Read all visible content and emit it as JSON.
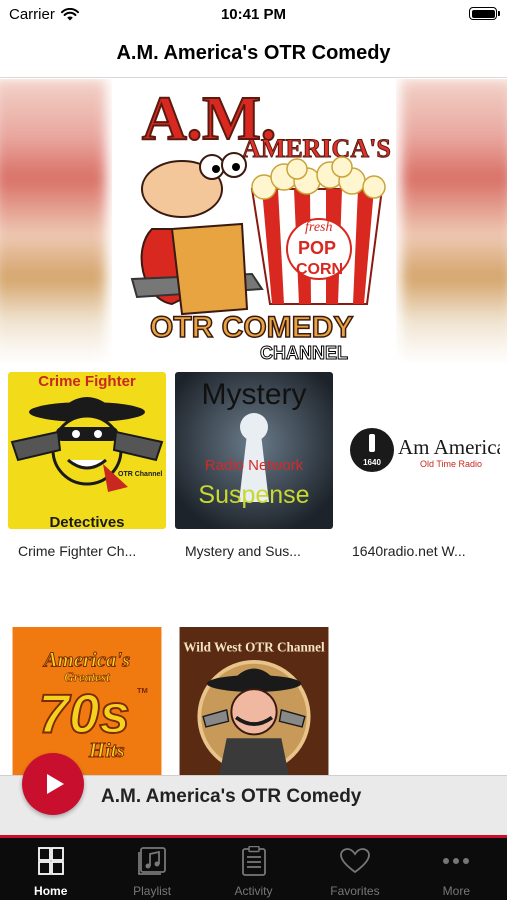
{
  "status_bar": {
    "carrier": "Carrier",
    "time": "10:41 PM",
    "battery_level": 1.0
  },
  "nav": {
    "title": "A.M. America's OTR Comedy"
  },
  "hero": {
    "logo_line1": "A.M.",
    "logo_line2": "AMERICA'S",
    "popcorn_word1": "fresh",
    "popcorn_word2": "POP",
    "popcorn_word3": "CORN",
    "otr_text": "OTR COMEDY",
    "channel_text": "CHANNEL"
  },
  "grid": {
    "items": [
      {
        "caption": "Crime Fighter Ch...",
        "art_top": "Crime Fighter",
        "art_badge": "OTR Channel",
        "art_bottom": "Detectives"
      },
      {
        "caption": "Mystery and Sus...",
        "art_top": "Mystery",
        "art_mid": "Radio Network",
        "art_bottom": "Suspense"
      },
      {
        "caption": "1640radio.net W...",
        "art_brand": "Am America",
        "art_sub": "Old Time Radio",
        "art_num": "1640"
      },
      {
        "caption": "",
        "art_line1": "America's",
        "art_line2": "Greatest",
        "art_line3": "70s",
        "art_line4": "Hits",
        "art_tm": "TM"
      },
      {
        "caption": "",
        "art_top": "Wild West OTR Channel"
      }
    ]
  },
  "mini_player": {
    "title": "A.M. America's OTR Comedy"
  },
  "tabs": [
    {
      "label": "Home",
      "icon": "grid-icon",
      "active": true
    },
    {
      "label": "Playlist",
      "icon": "music-note-icon",
      "active": false
    },
    {
      "label": "Activity",
      "icon": "list-icon",
      "active": false
    },
    {
      "label": "Favorites",
      "icon": "heart-icon",
      "active": false
    },
    {
      "label": "More",
      "icon": "ellipsis-icon",
      "active": false
    }
  ],
  "colors": {
    "accent_red": "#c8102e",
    "tab_bar_bg": "#0c0c0c",
    "mini_player_bg": "#eaeaea"
  }
}
